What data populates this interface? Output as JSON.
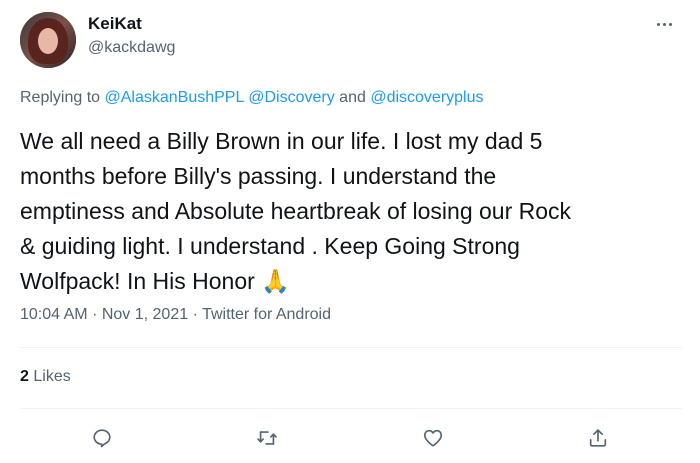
{
  "author": {
    "display_name": "KeiKat",
    "handle": "@kackdawg"
  },
  "reply": {
    "prefix": "Replying to",
    "mentions": [
      "@AlaskanBushPPL",
      "@Discovery",
      "@discoveryplus"
    ],
    "joiner": "and"
  },
  "body_lines": [
    "We all need a Billy Brown in our life. I lost my dad 5",
    "months before Billy's passing.  I understand the",
    "emptiness and Absolute heartbreak of losing our Rock",
    "& guiding light. I understand . Keep Going Strong",
    "Wolfpack! In His Honor"
  ],
  "body_emoji": "🙏",
  "meta": {
    "time": "10:04 AM",
    "date": "Nov 1, 2021",
    "source": "Twitter for Android",
    "separator": "·"
  },
  "stats": {
    "likes_count": "2",
    "likes_label": "Likes"
  },
  "actions": {
    "reply_icon": "reply-icon",
    "retweet_icon": "retweet-icon",
    "like_icon": "heart-icon",
    "share_icon": "share-icon"
  },
  "colors": {
    "text": "#0f1419",
    "secondary": "#536471",
    "link": "#1d9bf0",
    "divider": "#eff3f4"
  }
}
